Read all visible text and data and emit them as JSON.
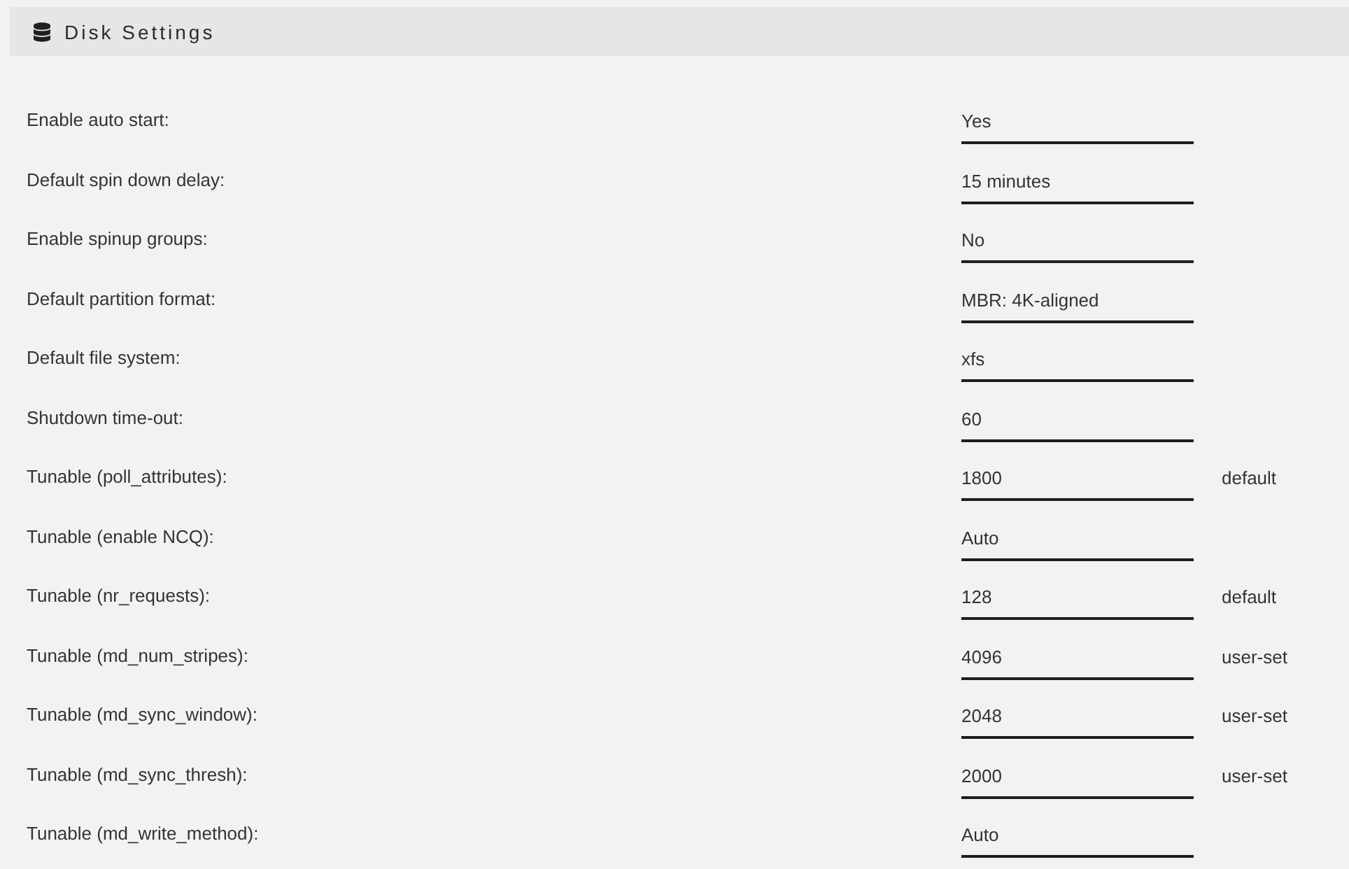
{
  "header": {
    "title": "Disk Settings"
  },
  "settings": [
    {
      "label": "Enable auto start:",
      "value": "Yes"
    },
    {
      "label": "Default spin down delay:",
      "value": "15 minutes"
    },
    {
      "label": "Enable spinup groups:",
      "value": "No"
    },
    {
      "label": "Default partition format:",
      "value": "MBR: 4K-aligned"
    },
    {
      "label": "Default file system:",
      "value": "xfs"
    },
    {
      "label": "Shutdown time-out:",
      "value": "60"
    },
    {
      "label": "Tunable (poll_attributes):",
      "value": "1800",
      "note": "default"
    },
    {
      "label": "Tunable (enable NCQ):",
      "value": "Auto"
    },
    {
      "label": "Tunable (nr_requests):",
      "value": "128",
      "note": "default"
    },
    {
      "label": "Tunable (md_num_stripes):",
      "value": "4096",
      "note": "user-set"
    },
    {
      "label": "Tunable (md_sync_window):",
      "value": "2048",
      "note": "user-set"
    },
    {
      "label": "Tunable (md_sync_thresh):",
      "value": "2000",
      "note": "user-set"
    },
    {
      "label": "Tunable (md_write_method):",
      "value": "Auto"
    }
  ]
}
